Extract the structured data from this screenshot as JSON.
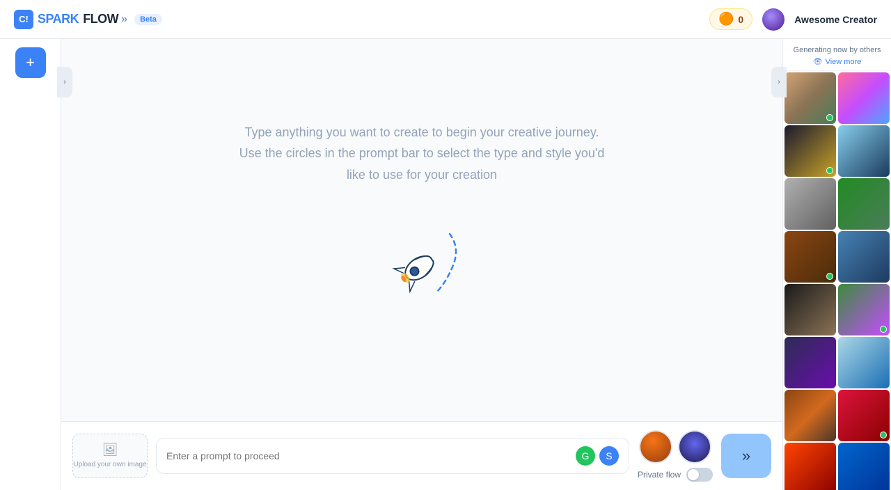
{
  "header": {
    "logo_spark": "SPARK",
    "logo_flow": "FLOW",
    "beta_label": "Beta",
    "coin_amount": "0",
    "username": "Awesome Creator"
  },
  "left_sidebar": {
    "add_button_label": "+"
  },
  "main": {
    "welcome_line1": "Type anything you want to create to begin your creative journey.",
    "welcome_line2": "Use the circles in the prompt bar to select the type and style you'd",
    "welcome_line3": "like to use for your creation"
  },
  "prompt_bar": {
    "upload_label": "Upload your own image",
    "placeholder": "Enter a prompt to proceed",
    "private_flow_label": "Private flow",
    "send_icon": "»"
  },
  "right_sidebar": {
    "generating_label": "Generating now by others",
    "view_more_label": "View more",
    "gallery_items": [
      {
        "id": 1,
        "css_class": "gi1",
        "online": true
      },
      {
        "id": 2,
        "css_class": "gi2",
        "online": false
      },
      {
        "id": 3,
        "css_class": "gi3",
        "online": true
      },
      {
        "id": 4,
        "css_class": "gi4",
        "online": false
      },
      {
        "id": 5,
        "css_class": "gi5",
        "online": false
      },
      {
        "id": 6,
        "css_class": "gi6",
        "online": false
      },
      {
        "id": 7,
        "css_class": "gi7",
        "online": true
      },
      {
        "id": 8,
        "css_class": "gi8",
        "online": false
      },
      {
        "id": 9,
        "css_class": "gi9",
        "online": false
      },
      {
        "id": 10,
        "css_class": "gi10",
        "online": true
      },
      {
        "id": 11,
        "css_class": "gi11",
        "online": false
      },
      {
        "id": 12,
        "css_class": "gi12",
        "online": false
      },
      {
        "id": 13,
        "css_class": "gi13",
        "online": false
      },
      {
        "id": 14,
        "css_class": "gi14",
        "online": true
      },
      {
        "id": 15,
        "css_class": "gi15",
        "online": false
      },
      {
        "id": 16,
        "css_class": "gi16",
        "online": false
      }
    ]
  }
}
